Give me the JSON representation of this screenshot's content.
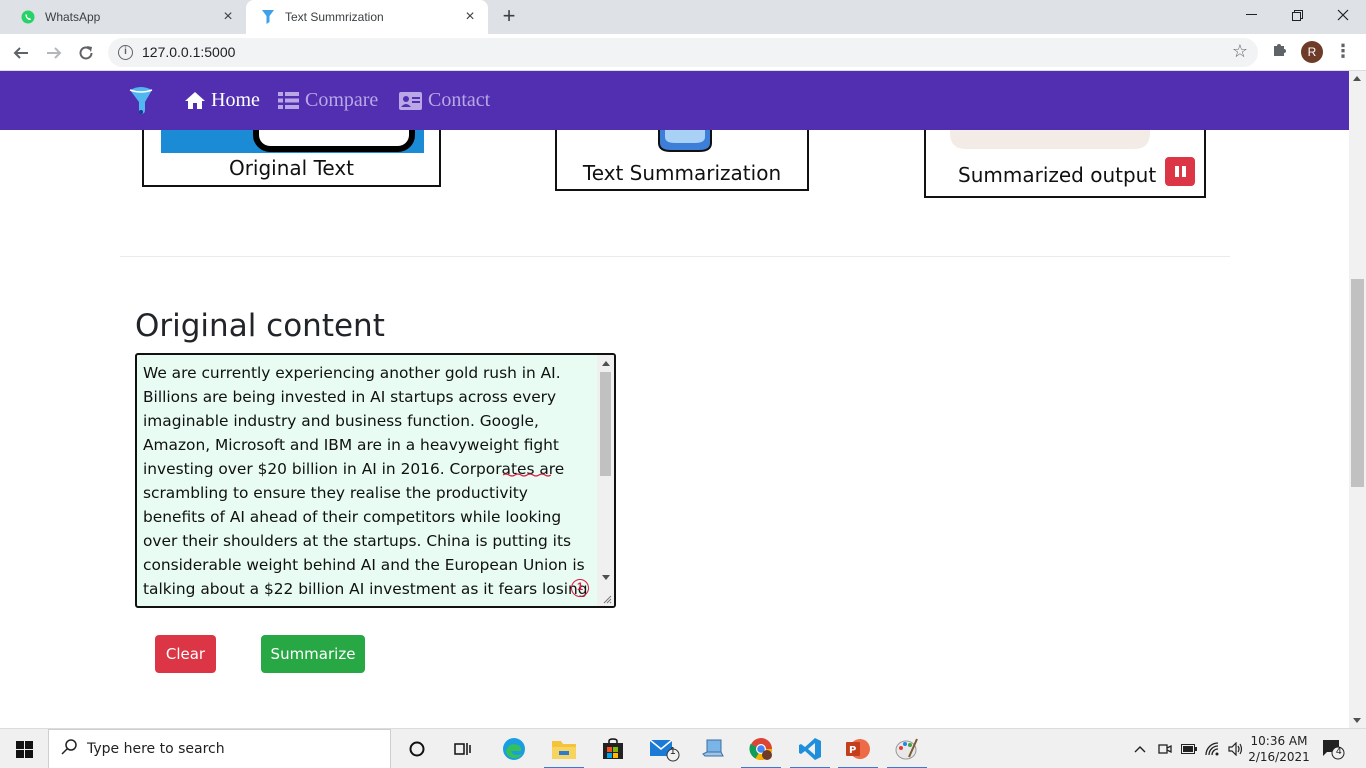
{
  "browser": {
    "tabs": [
      {
        "title": "WhatsApp",
        "favicon": "whatsapp-icon"
      },
      {
        "title": "Text Summrization",
        "favicon": "funnel-icon",
        "active": true
      }
    ],
    "url": "127.0.0.1:5000",
    "profile_initial": "R"
  },
  "navbar": {
    "accent_color": "#512fb0",
    "links": [
      {
        "label": "Home",
        "icon": "home-icon",
        "active": true
      },
      {
        "label": "Compare",
        "icon": "list-icon",
        "active": false
      },
      {
        "label": "Contact",
        "icon": "id-card-icon",
        "active": false
      }
    ]
  },
  "flow": {
    "boxes": [
      "Original Text",
      "Text Summarization",
      "Summarized output"
    ]
  },
  "main": {
    "section_title": "Original content",
    "original_text": "We are currently experiencing another gold rush in AI. Billions are being invested in AI startups across every imaginable industry and business function. Google, Amazon, Microsoft and IBM are in a heavyweight fight investing over $20 billion in AI in 2016. Corporates are scrambling to ensure they realise the productivity benefits of AI ahead of their competitors while looking over their shoulders at the startups. China is putting its considerable weight behind AI and the European Union is talking about a $22 billion AI investment as it fears losing ground to China and the US.",
    "spell_count": "1",
    "buttons": {
      "clear": "Clear",
      "summarize": "Summarize"
    }
  },
  "taskbar": {
    "search_placeholder": "Type here to search",
    "time": "10:36 AM",
    "date": "2/16/2021",
    "notification_count": "4",
    "mail_badge": "1"
  }
}
